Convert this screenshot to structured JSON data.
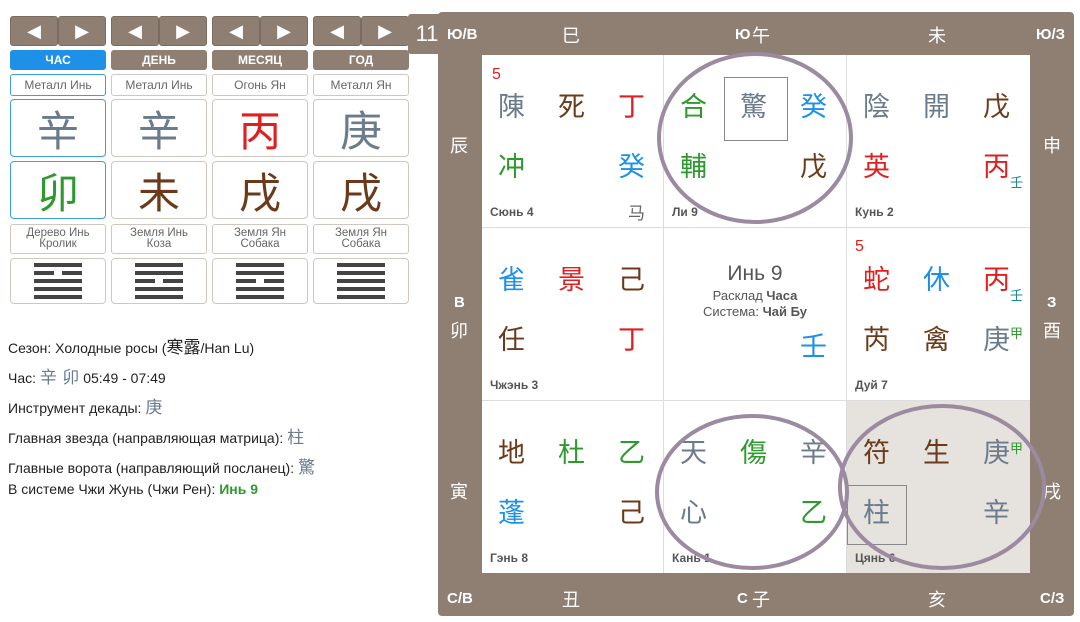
{
  "colors": {
    "accent": "#1e90e8",
    "brown": "#8e7f72"
  },
  "pillars": [
    {
      "label": "ЧАС",
      "element": "Металл Инь",
      "stem": "辛",
      "branch": "卯",
      "branch_desc1": "Дерево Инь",
      "branch_desc2": "Кролик",
      "active": true
    },
    {
      "label": "ДЕНЬ",
      "element": "Металл Инь",
      "stem": "辛",
      "branch": "未",
      "branch_desc1": "Земля Инь",
      "branch_desc2": "Коза",
      "active": false
    },
    {
      "label": "МЕСЯЦ",
      "element": "Огонь Ян",
      "stem": "丙",
      "branch": "戌",
      "branch_desc1": "Земля Ян",
      "branch_desc2": "Собака",
      "active": false
    },
    {
      "label": "ГОД",
      "element": "Металл Ян",
      "stem": "庚",
      "branch": "戌",
      "branch_desc1": "Земля Ян",
      "branch_desc2": "Собака",
      "active": false
    }
  ],
  "nav": {
    "prev": "◀",
    "next": "▶"
  },
  "info": {
    "season_label": "Сезон:",
    "season_value": "Холодные росы (",
    "season_cn": "寒露",
    "season_tail": "/Han Lu)",
    "hour_label": "Час:",
    "hour_cn": "辛 卯",
    "hour_time": "05:49 - 07:49",
    "decade_label": "Инструмент декады:",
    "decade_value": "庚",
    "star_label": "Главная звезда (направляющая матрица):",
    "star_value": "柱",
    "gate_label": "Главные ворота (направляющий посланец):",
    "gate_value": "驚",
    "system_label": "В системе Чжи Жунь (Чжи Рен):",
    "system_value": "Инь 9"
  },
  "board": {
    "number": "11",
    "corners": {
      "tl": "Ю/В",
      "tr": "Ю/З",
      "bl": "С/В",
      "br": "С/З"
    },
    "top": {
      "b1": "巳",
      "dir": "Ю",
      "b2": "午",
      "b3": "未"
    },
    "bottom": {
      "b1": "丑",
      "dir": "С",
      "b2": "子",
      "b3": "亥"
    },
    "left": {
      "b1": "辰",
      "dir": "В",
      "b2": "卯",
      "b3": "寅"
    },
    "right": {
      "b1": "申",
      "dir": "З",
      "b2": "酉",
      "b3": "戌"
    },
    "center": {
      "title": "Инь 9",
      "l1a": "Расклад ",
      "l1b": "Часа",
      "l2a": "Система: ",
      "l2b": "Чай Бу",
      "stem": "壬"
    },
    "palaces": {
      "xun": "Сюнь 4",
      "li": "Ли 9",
      "kun": "Кунь 2",
      "zhen": "Чжэнь 3",
      "dui": "Дуй 7",
      "gen": "Гэнь 8",
      "kan": "Кань 1",
      "qian": "Цянь 6"
    },
    "num5a": "5",
    "num5b": "5",
    "cells": {
      "xun": [
        "陳",
        "死",
        "丁",
        "冲",
        "癸",
        "马"
      ],
      "li": [
        "合",
        "驚",
        "癸",
        "輔",
        "戊"
      ],
      "kun": [
        "陰",
        "開",
        "戊",
        "英",
        "丙",
        "壬"
      ],
      "zhen": [
        "雀",
        "景",
        "己",
        "任",
        "丁"
      ],
      "dui": [
        "蛇",
        "休",
        "丙",
        "壬",
        "芮",
        "禽",
        "庚",
        "甲"
      ],
      "gen": [
        "地",
        "杜",
        "乙",
        "蓬",
        "己"
      ],
      "kan": [
        "天",
        "傷",
        "辛",
        "心",
        "乙"
      ],
      "qian": [
        "符",
        "生",
        "庚",
        "甲",
        "柱",
        "辛"
      ]
    }
  }
}
